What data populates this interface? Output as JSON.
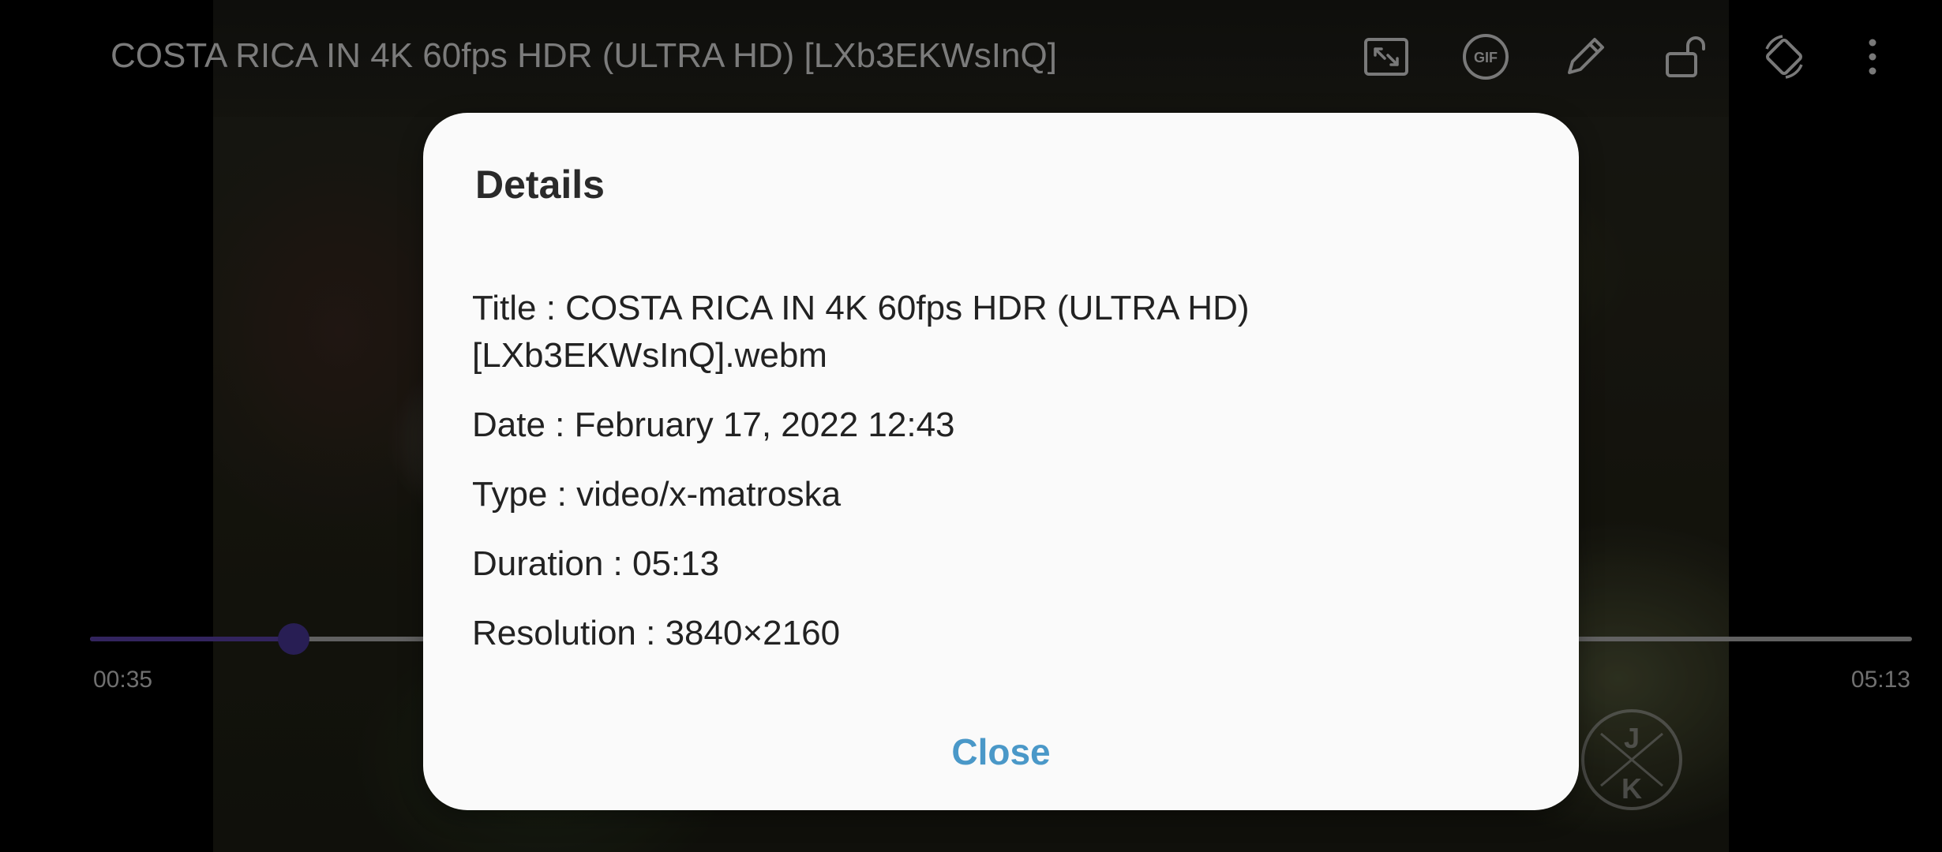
{
  "player": {
    "video_title": "COSTA RICA IN 4K 60fps HDR (ULTRA HD) [LXb3EKWsInQ]",
    "current_time": "00:35",
    "total_time": "05:13",
    "progress": 0.112,
    "accent_color": "#3a2a6b",
    "toolbar_icons": [
      "screen-fit-icon",
      "gif-icon",
      "edit-icon",
      "unlock-icon",
      "rotate-icon",
      "more-options-icon"
    ],
    "gif_label": "GIF",
    "watermark_letters": [
      "J",
      "K"
    ]
  },
  "dialog": {
    "title": "Details",
    "details": {
      "title": "Title : COSTA RICA IN 4K 60fps HDR (ULTRA HD) [LXb3EKWsInQ].webm",
      "date": "Date : February 17, 2022 12:43",
      "type": "Type : video/x-matroska",
      "duration": "Duration : 05:13",
      "resolution": "Resolution : 3840×2160"
    },
    "close_label": "Close",
    "close_color": "#4a98c8"
  }
}
